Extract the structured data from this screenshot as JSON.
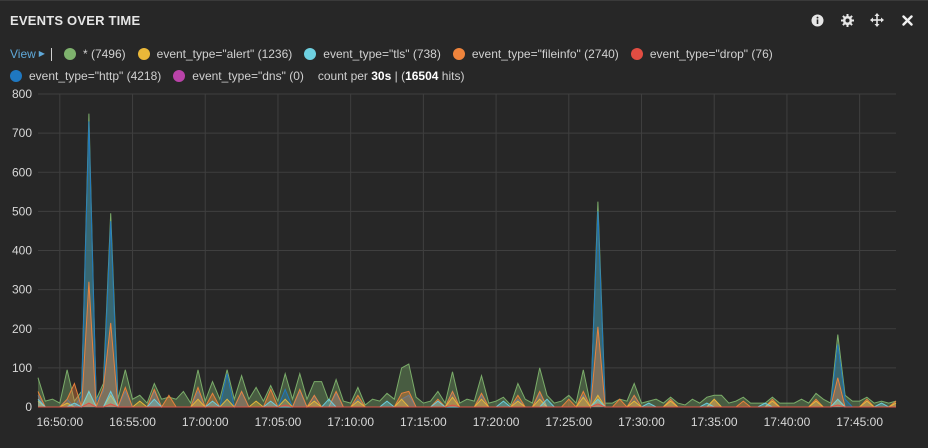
{
  "panel": {
    "title": "EVENTS OVER TIME",
    "icons": [
      "info-icon",
      "gear-icon",
      "move-icon",
      "close-icon"
    ]
  },
  "legend": {
    "view_label": "View",
    "items": [
      {
        "label": "* (7496)",
        "color": "#7eb26d"
      },
      {
        "label": "event_type=\"alert\" (1236)",
        "color": "#eab839"
      },
      {
        "label": "event_type=\"tls\" (738)",
        "color": "#6ed0e0"
      },
      {
        "label": "event_type=\"fileinfo\" (2740)",
        "color": "#ef843c"
      },
      {
        "label": "event_type=\"drop\" (76)",
        "color": "#e24d42"
      },
      {
        "label": "event_type=\"http\" (4218)",
        "color": "#1f78c1"
      },
      {
        "label": "event_type=\"dns\" (0)",
        "color": "#ba43a9"
      }
    ],
    "count_prefix": "count per ",
    "interval": "30s",
    "hits_prefix": " | (",
    "hits": "16504",
    "hits_suffix": " hits)"
  },
  "chart_data": {
    "type": "area",
    "ylim": [
      0,
      800
    ],
    "yticks": [
      0,
      100,
      200,
      300,
      400,
      500,
      600,
      700,
      800
    ],
    "xticks": [
      "16:50:00",
      "16:55:00",
      "17:00:00",
      "17:05:00",
      "17:10:00",
      "17:15:00",
      "17:20:00",
      "17:25:00",
      "17:30:00",
      "17:35:00",
      "17:40:00",
      "17:45:00"
    ],
    "x_start": "16:48:30",
    "x_end": "17:47:30",
    "interval_seconds": 30,
    "grid": true,
    "series": [
      {
        "name": "* (7496)",
        "color": "#7eb26d",
        "peaks": [
          [
            0,
            75
          ],
          [
            1,
            15
          ],
          [
            2,
            20
          ],
          [
            3,
            10
          ],
          [
            4,
            95
          ],
          [
            5,
            15
          ],
          [
            6,
            40
          ],
          [
            7,
            750
          ],
          [
            8,
            20
          ],
          [
            9,
            60
          ],
          [
            10,
            495
          ],
          [
            11,
            20
          ],
          [
            12,
            95
          ],
          [
            13,
            20
          ],
          [
            14,
            30
          ],
          [
            15,
            10
          ],
          [
            16,
            60
          ],
          [
            17,
            20
          ],
          [
            18,
            25
          ],
          [
            19,
            20
          ],
          [
            20,
            40
          ],
          [
            21,
            10
          ],
          [
            22,
            95
          ],
          [
            23,
            15
          ],
          [
            24,
            65
          ],
          [
            25,
            20
          ],
          [
            26,
            95
          ],
          [
            27,
            20
          ],
          [
            28,
            80
          ],
          [
            29,
            20
          ],
          [
            30,
            50
          ],
          [
            31,
            15
          ],
          [
            32,
            55
          ],
          [
            33,
            15
          ],
          [
            34,
            85
          ],
          [
            35,
            20
          ],
          [
            36,
            85
          ],
          [
            37,
            20
          ],
          [
            38,
            65
          ],
          [
            39,
            65
          ],
          [
            40,
            15
          ],
          [
            41,
            70
          ],
          [
            42,
            15
          ],
          [
            43,
            10
          ],
          [
            44,
            50
          ],
          [
            45,
            5
          ],
          [
            46,
            20
          ],
          [
            47,
            15
          ],
          [
            48,
            35
          ],
          [
            49,
            20
          ],
          [
            50,
            100
          ],
          [
            51,
            110
          ],
          [
            52,
            25
          ],
          [
            53,
            10
          ],
          [
            54,
            15
          ],
          [
            55,
            40
          ],
          [
            56,
            10
          ],
          [
            57,
            90
          ],
          [
            58,
            10
          ],
          [
            59,
            20
          ],
          [
            60,
            15
          ],
          [
            61,
            80
          ],
          [
            62,
            10
          ],
          [
            63,
            15
          ],
          [
            64,
            25
          ],
          [
            65,
            5
          ],
          [
            66,
            60
          ],
          [
            67,
            20
          ],
          [
            68,
            10
          ],
          [
            69,
            100
          ],
          [
            70,
            30
          ],
          [
            71,
            10
          ],
          [
            72,
            15
          ],
          [
            73,
            30
          ],
          [
            74,
            10
          ],
          [
            75,
            95
          ],
          [
            76,
            5
          ],
          [
            77,
            525
          ],
          [
            78,
            10
          ],
          [
            79,
            10
          ],
          [
            80,
            20
          ],
          [
            81,
            15
          ],
          [
            82,
            60
          ],
          [
            83,
            10
          ],
          [
            84,
            15
          ],
          [
            85,
            20
          ],
          [
            86,
            10
          ],
          [
            87,
            25
          ],
          [
            88,
            10
          ],
          [
            89,
            5
          ],
          [
            90,
            20
          ],
          [
            91,
            10
          ],
          [
            92,
            25
          ],
          [
            93,
            30
          ],
          [
            94,
            30
          ],
          [
            95,
            10
          ],
          [
            96,
            15
          ],
          [
            97,
            25
          ],
          [
            98,
            10
          ],
          [
            99,
            10
          ],
          [
            100,
            10
          ],
          [
            101,
            25
          ],
          [
            102,
            10
          ],
          [
            103,
            10
          ],
          [
            104,
            10
          ],
          [
            105,
            20
          ],
          [
            106,
            10
          ],
          [
            107,
            35
          ],
          [
            108,
            20
          ],
          [
            109,
            10
          ],
          [
            110,
            185
          ],
          [
            111,
            30
          ],
          [
            112,
            15
          ],
          [
            113,
            15
          ],
          [
            114,
            25
          ],
          [
            115,
            10
          ],
          [
            116,
            15
          ],
          [
            117,
            10
          ],
          [
            118,
            15
          ]
        ]
      },
      {
        "name": "event_type=\"alert\" (1236)",
        "color": "#eab839",
        "peaks": [
          [
            0,
            15
          ],
          [
            4,
            10
          ],
          [
            7,
            40
          ],
          [
            10,
            30
          ],
          [
            14,
            15
          ],
          [
            22,
            20
          ],
          [
            26,
            20
          ],
          [
            30,
            15
          ],
          [
            34,
            20
          ],
          [
            38,
            15
          ],
          [
            44,
            15
          ],
          [
            50,
            20
          ],
          [
            57,
            25
          ],
          [
            61,
            20
          ],
          [
            66,
            15
          ],
          [
            69,
            20
          ],
          [
            75,
            25
          ],
          [
            77,
            30
          ],
          [
            82,
            15
          ],
          [
            87,
            15
          ],
          [
            93,
            20
          ],
          [
            101,
            15
          ],
          [
            107,
            15
          ],
          [
            110,
            20
          ],
          [
            114,
            15
          ],
          [
            118,
            10
          ]
        ]
      },
      {
        "name": "event_type=\"tls\" (738)",
        "color": "#6ed0e0",
        "peaks": [
          [
            0,
            20
          ],
          [
            5,
            10
          ],
          [
            7,
            40
          ],
          [
            10,
            40
          ],
          [
            16,
            20
          ],
          [
            24,
            15
          ],
          [
            32,
            15
          ],
          [
            40,
            20
          ],
          [
            48,
            15
          ],
          [
            55,
            15
          ],
          [
            64,
            15
          ],
          [
            70,
            20
          ],
          [
            77,
            20
          ],
          [
            84,
            10
          ],
          [
            92,
            10
          ],
          [
            100,
            10
          ],
          [
            110,
            20
          ],
          [
            116,
            10
          ]
        ]
      },
      {
        "name": "event_type=\"fileinfo\" (2740)",
        "color": "#ef843c",
        "peaks": [
          [
            0,
            40
          ],
          [
            4,
            20
          ],
          [
            5,
            60
          ],
          [
            7,
            320
          ],
          [
            9,
            50
          ],
          [
            10,
            215
          ],
          [
            12,
            50
          ],
          [
            16,
            45
          ],
          [
            18,
            30
          ],
          [
            22,
            50
          ],
          [
            24,
            35
          ],
          [
            28,
            40
          ],
          [
            32,
            45
          ],
          [
            36,
            45
          ],
          [
            38,
            30
          ],
          [
            41,
            40
          ],
          [
            44,
            30
          ],
          [
            50,
            35
          ],
          [
            51,
            40
          ],
          [
            55,
            20
          ],
          [
            57,
            40
          ],
          [
            61,
            35
          ],
          [
            66,
            30
          ],
          [
            69,
            40
          ],
          [
            73,
            20
          ],
          [
            75,
            40
          ],
          [
            77,
            205
          ],
          [
            80,
            20
          ],
          [
            82,
            30
          ],
          [
            87,
            20
          ],
          [
            93,
            20
          ],
          [
            97,
            15
          ],
          [
            101,
            20
          ],
          [
            107,
            20
          ],
          [
            110,
            75
          ],
          [
            114,
            20
          ],
          [
            118,
            15
          ]
        ]
      },
      {
        "name": "event_type=\"drop\" (76)",
        "color": "#e24d42",
        "peaks": [
          [
            7,
            10
          ],
          [
            10,
            8
          ],
          [
            34,
            5
          ],
          [
            57,
            5
          ],
          [
            77,
            8
          ],
          [
            110,
            5
          ]
        ]
      },
      {
        "name": "event_type=\"http\" (4218)",
        "color": "#1f78c1",
        "peaks": [
          [
            0,
            30
          ],
          [
            4,
            20
          ],
          [
            6,
            30
          ],
          [
            7,
            730
          ],
          [
            8,
            15
          ],
          [
            9,
            40
          ],
          [
            10,
            475
          ],
          [
            12,
            40
          ],
          [
            16,
            40
          ],
          [
            22,
            40
          ],
          [
            26,
            85
          ],
          [
            28,
            40
          ],
          [
            34,
            45
          ],
          [
            36,
            40
          ],
          [
            38,
            30
          ],
          [
            41,
            35
          ],
          [
            44,
            20
          ],
          [
            50,
            20
          ],
          [
            51,
            30
          ],
          [
            57,
            40
          ],
          [
            61,
            30
          ],
          [
            66,
            20
          ],
          [
            69,
            35
          ],
          [
            75,
            30
          ],
          [
            77,
            500
          ],
          [
            82,
            30
          ],
          [
            87,
            20
          ],
          [
            93,
            20
          ],
          [
            101,
            15
          ],
          [
            107,
            15
          ],
          [
            110,
            160
          ],
          [
            111,
            20
          ],
          [
            114,
            15
          ],
          [
            118,
            10
          ]
        ]
      },
      {
        "name": "event_type=\"dns\" (0)",
        "color": "#ba43a9",
        "peaks": []
      }
    ]
  }
}
